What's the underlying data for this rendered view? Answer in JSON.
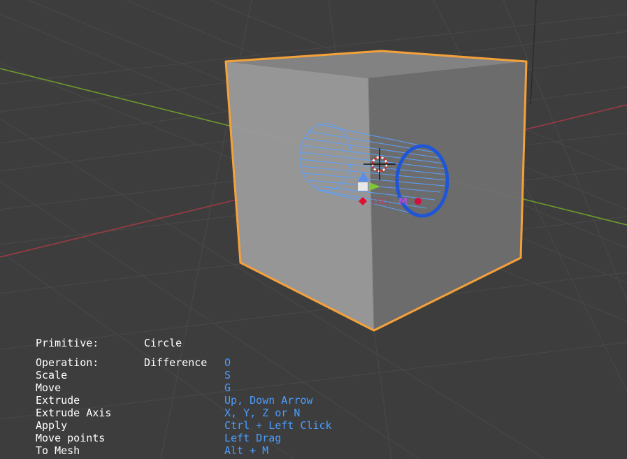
{
  "overlay": {
    "primitive": {
      "label": "Primitive:",
      "value": "Circle"
    },
    "operation": {
      "label": "Operation:",
      "value": "Difference",
      "key": "O"
    },
    "rows": [
      {
        "label": "Scale",
        "key": "S"
      },
      {
        "label": "Move",
        "key": "G"
      },
      {
        "label": "Extrude",
        "key": "Up, Down Arrow"
      },
      {
        "label": "Extrude Axis",
        "key": "X, Y, Z or N"
      },
      {
        "label": "Apply",
        "key": "Ctrl + Left Click"
      },
      {
        "label": "Move points",
        "key": "Left Drag"
      },
      {
        "label": "To Mesh",
        "key": "Alt + M"
      }
    ]
  },
  "colors": {
    "background": "#3d3d3d",
    "grid": "#474747",
    "x_axis": "#9b3a45",
    "y_axis": "#6d9a2c",
    "selection_outline": "#f5a13a",
    "cube_front": "#9a9a9a",
    "cube_side": "#6e6e6e",
    "cube_top": "#8a8a8a",
    "cylinder_wire": "#5aa0ff",
    "circle_ring": "#1f56d6",
    "hotkey_text": "#4a9dff"
  },
  "icons": [
    "3d-cursor-icon",
    "move-gizmo-icon",
    "vertex-marker-icon"
  ]
}
